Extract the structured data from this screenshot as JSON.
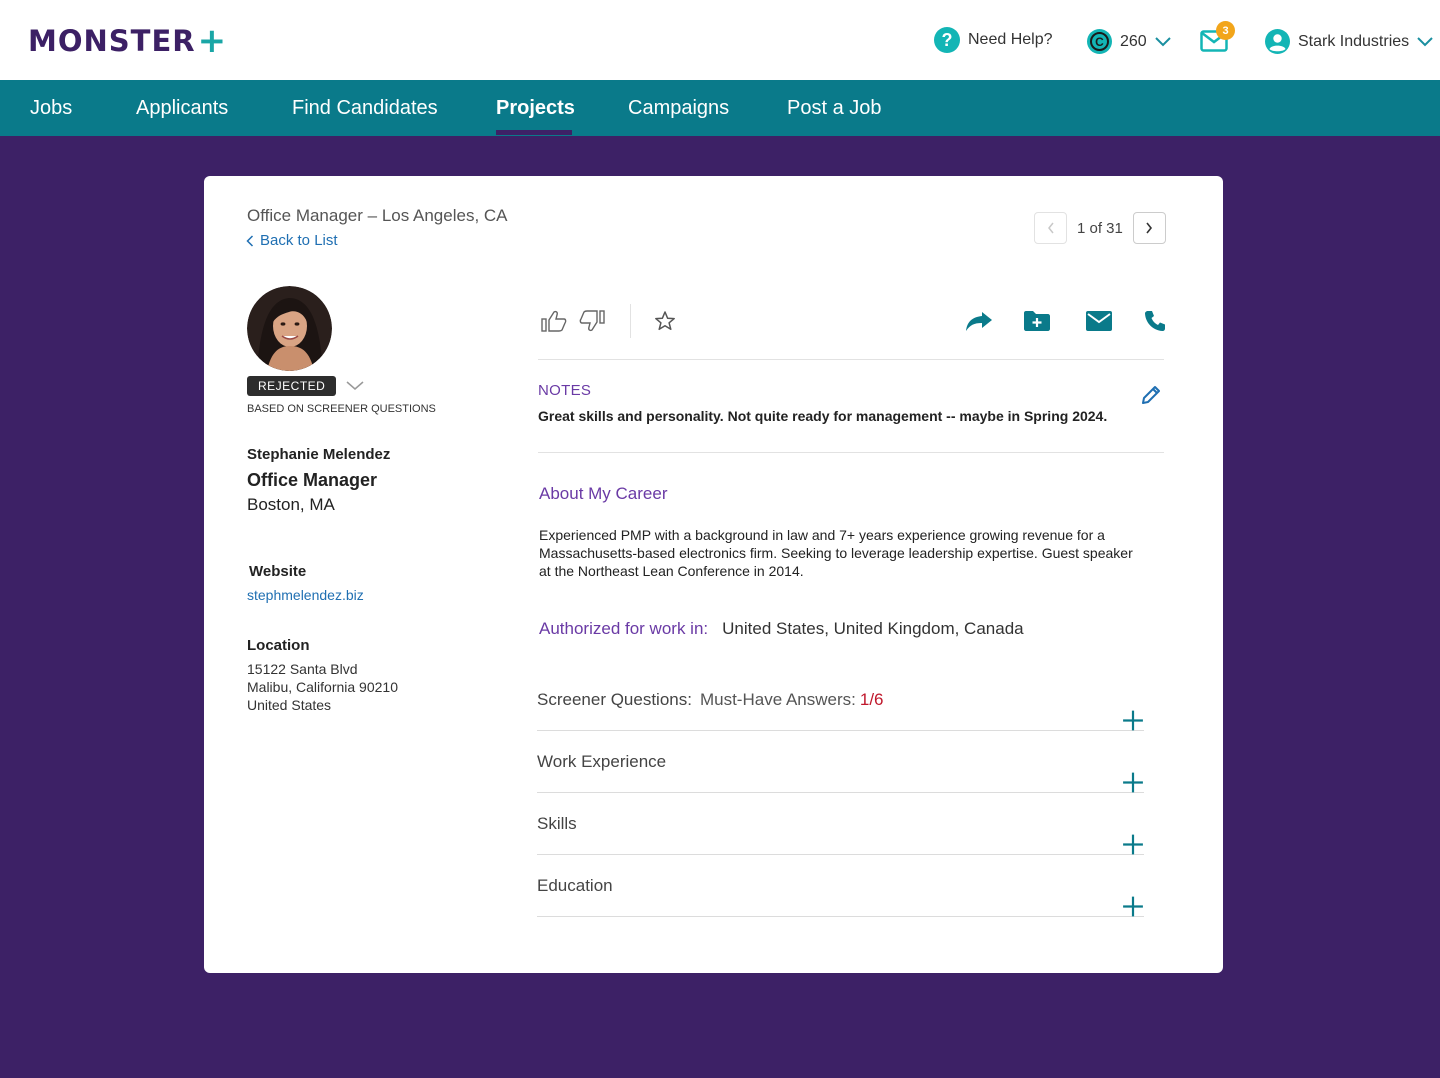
{
  "header": {
    "logo_text": "MONSTER",
    "logo_plus": "+",
    "help_label": "Need Help?",
    "credits": "260",
    "mail_count": "3",
    "account_name": "Stark Industries"
  },
  "nav": {
    "items": [
      {
        "label": "Jobs"
      },
      {
        "label": "Applicants"
      },
      {
        "label": "Find Candidates"
      },
      {
        "label": "Projects"
      },
      {
        "label": "Campaigns"
      },
      {
        "label": "Post a Job"
      }
    ],
    "active": "Projects"
  },
  "card": {
    "job_title": "Office Manager – Los Angeles, CA",
    "back_label": "Back to List",
    "pager_text": "1 of 31"
  },
  "candidate": {
    "status": "REJECTED",
    "status_note": "BASED ON SCREENER QUESTIONS",
    "name": "Stephanie Melendez",
    "title": "Office Manager",
    "location": "Boston, MA",
    "website_label": "Website",
    "website": "stephmelendez.biz",
    "location_label": "Location",
    "address": [
      "15122 Santa Blvd",
      "Malibu, California 90210",
      "United States"
    ]
  },
  "profile": {
    "notes_label": "NOTES",
    "notes_text": "Great skills and personality. Not quite ready for management -- maybe in Spring 2024.",
    "about_title": "About My Career",
    "about_text": "Experienced PMP with a background in law and 7+ years experience growing revenue for a Massachusetts-based electronics firm. Seeking to leverage leadership expertise. Guest speaker at the Northeast Lean Conference in 2014.",
    "auth_label": "Authorized for work in:",
    "auth_value": "United States, United Kingdom, Canada",
    "sections": [
      {
        "label": "Screener Questions:",
        "sub_label": "Must-Have Answers:",
        "sub_value": "1/6"
      },
      {
        "label": "Work Experience"
      },
      {
        "label": "Skills"
      },
      {
        "label": "Education"
      }
    ]
  },
  "colors": {
    "brand_purple": "#3c2065",
    "brand_teal": "#0a7a8a",
    "accent_purple": "#6a3aa5",
    "alert_red": "#c0182c"
  }
}
